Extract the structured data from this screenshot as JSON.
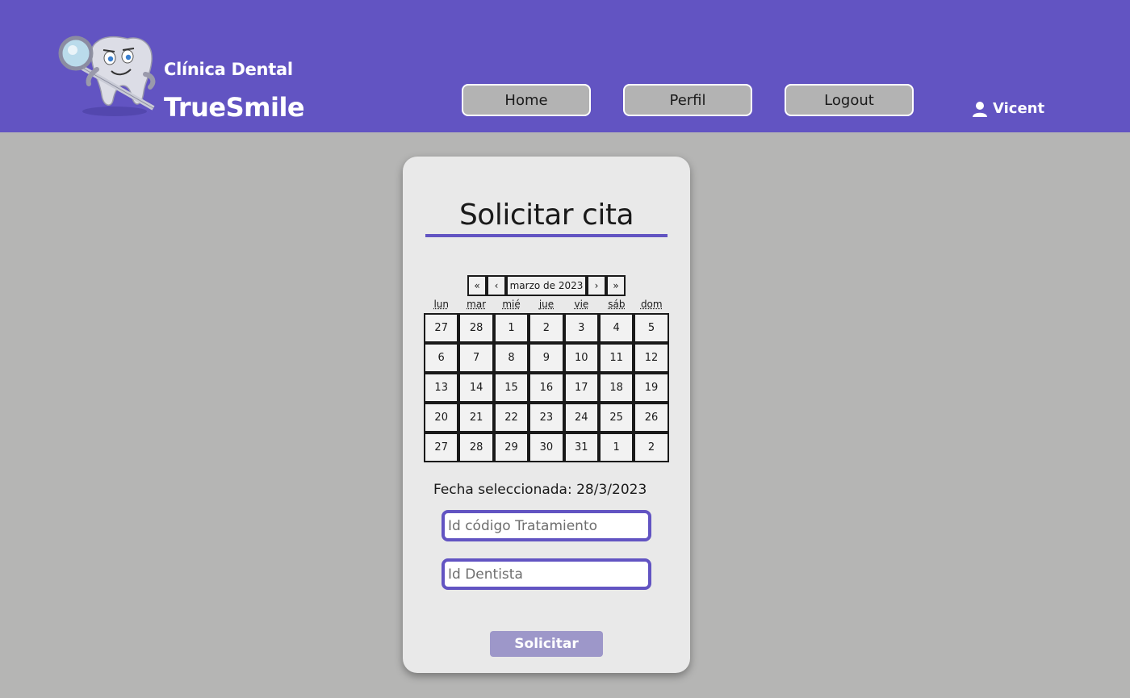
{
  "header": {
    "brand_sub": "Clínica Dental",
    "brand_main": "TrueSmile",
    "nav": [
      {
        "label": "Home"
      },
      {
        "label": "Perfil"
      },
      {
        "label": "Logout"
      }
    ],
    "user_name": "Vicent",
    "user_icon": "user-icon",
    "logo_icon": "tooth-magnifier-logo"
  },
  "colors": {
    "brand": "#6254c2",
    "background": "#b5b5b4",
    "card": "#e9e9e9",
    "nav_button": "#b3b3b3",
    "submit_button": "#9d97c9"
  },
  "form": {
    "title": "Solicitar cita",
    "calendar": {
      "first": "«",
      "prev": "‹",
      "month_label": "marzo de 2023",
      "next": "›",
      "last": "»",
      "weekdays": [
        "lun",
        "mar",
        "mié",
        "jue",
        "vie",
        "sáb",
        "dom"
      ],
      "days": [
        "27",
        "28",
        "1",
        "2",
        "3",
        "4",
        "5",
        "6",
        "7",
        "8",
        "9",
        "10",
        "11",
        "12",
        "13",
        "14",
        "15",
        "16",
        "17",
        "18",
        "19",
        "20",
        "21",
        "22",
        "23",
        "24",
        "25",
        "26",
        "27",
        "28",
        "29",
        "30",
        "31",
        "1",
        "2"
      ]
    },
    "selected_date": "Fecha seleccionada: 28/3/2023",
    "treatment_placeholder": "Id código Tratamiento",
    "treatment_value": "",
    "dentist_placeholder": "Id Dentista",
    "dentist_value": "",
    "submit_label": "Solicitar"
  }
}
